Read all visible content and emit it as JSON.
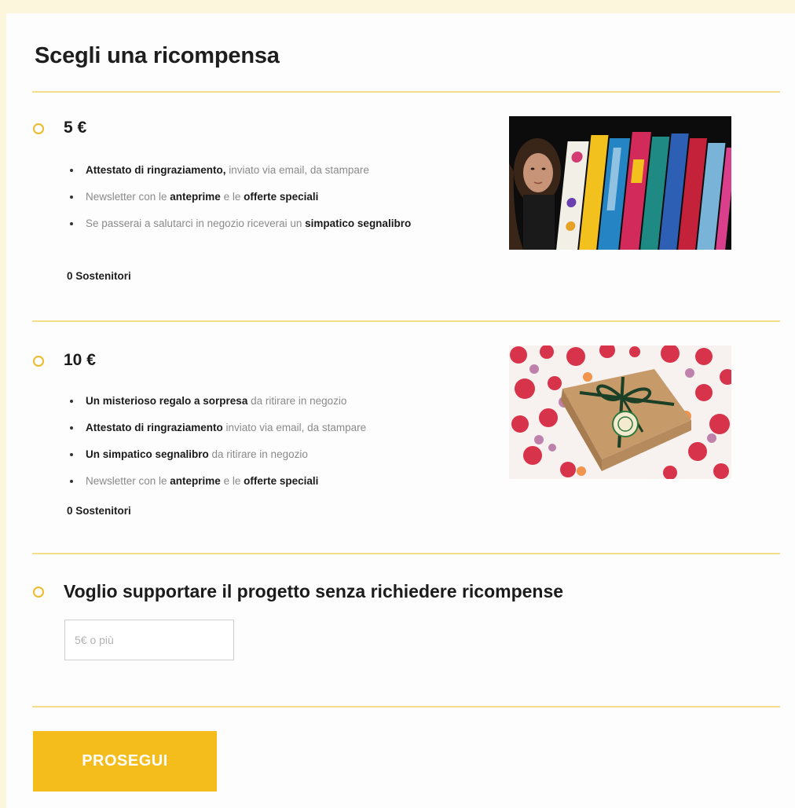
{
  "title": "Scegli una ricompensa",
  "rewards": [
    {
      "price": "5 €",
      "perks": [
        {
          "strong": "Attestato di ringraziamento,",
          "rest": " inviato via email, da stampare"
        },
        {
          "pre": "Newsletter con le ",
          "strong": "anteprime",
          "mid": " e le ",
          "strong2": "offerte speciali"
        },
        {
          "pre": "Se passerai a salutarci in negozio riceverai un ",
          "strong": "simpatico segnalibro"
        }
      ],
      "backers": "0 Sostenitori",
      "image": "books-photo"
    },
    {
      "price": "10 €",
      "perks": [
        {
          "strong": "Un misterioso regalo a sorpresa",
          "rest": " da ritirare in negozio"
        },
        {
          "strong": "Attestato di ringraziamento",
          "rest": " inviato via email, da stampare"
        },
        {
          "strong": "Un simpatico segnalibro",
          "rest": " da ritirare in negozio"
        },
        {
          "pre": "Newsletter con le ",
          "strong": "anteprime",
          "mid": " e le ",
          "strong2": "offerte speciali"
        }
      ],
      "backers": "0 Sostenitori",
      "image": "gift-box-photo"
    }
  ],
  "no_reward": {
    "label": "Voglio supportare il progetto senza richiedere ricompense",
    "placeholder": "5€ o più"
  },
  "continue_label": "PROSEGUI",
  "colors": {
    "accent": "#f5bd1c",
    "radio": "#f0b92a",
    "divider": "#f6dd8a",
    "page_bg": "#fbf6dc"
  }
}
